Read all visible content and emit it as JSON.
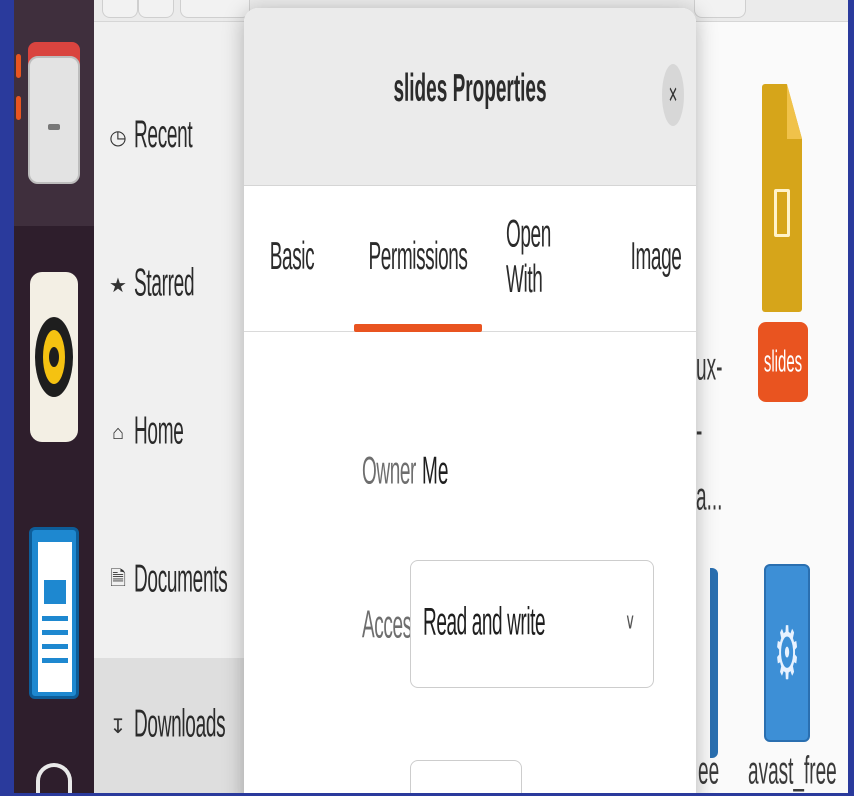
{
  "sidebar": {
    "items": [
      {
        "label": "Recent",
        "icon": "clock-icon"
      },
      {
        "label": "Starred",
        "icon": "star-icon"
      },
      {
        "label": "Home",
        "icon": "home-icon"
      },
      {
        "label": "Documents",
        "icon": "document-icon"
      },
      {
        "label": "Downloads",
        "icon": "download-icon"
      }
    ]
  },
  "background_files": {
    "truncated_name_lines": [
      "ux-",
      "-",
      "a..."
    ],
    "slides_label": "slides",
    "bottom_labels": [
      "ee",
      "avast_free"
    ]
  },
  "dialog": {
    "title": "slides Properties",
    "close_glyph": "×",
    "tabs": [
      {
        "label": "Basic",
        "active": false
      },
      {
        "label": "Permissions",
        "active": true
      },
      {
        "label": "Open With",
        "active": false
      },
      {
        "label": "Image",
        "active": false
      }
    ],
    "permissions": {
      "owner_label": "Owner",
      "owner_value": "Me",
      "access_label": "Access",
      "access_value": "Read and write"
    }
  },
  "colors": {
    "accent": "#e95420",
    "border": "#2a3a9c",
    "dock": "#2e1e2c"
  }
}
